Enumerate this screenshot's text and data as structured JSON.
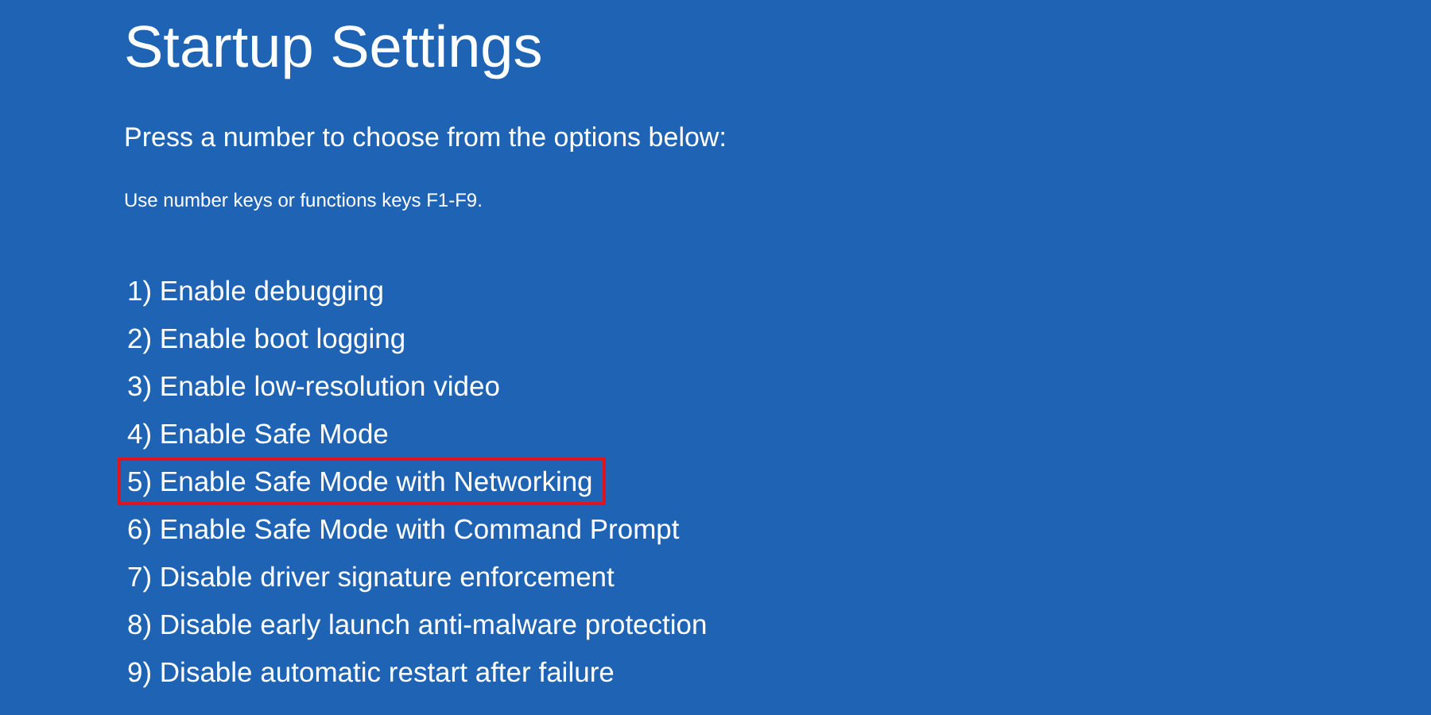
{
  "title": "Startup Settings",
  "prompt": "Press a number to choose from the options below:",
  "hint": "Use number keys or functions keys F1-F9.",
  "options": [
    {
      "label": "1) Enable debugging",
      "highlighted": false
    },
    {
      "label": "2) Enable boot logging",
      "highlighted": false
    },
    {
      "label": "3) Enable low-resolution video",
      "highlighted": false
    },
    {
      "label": "4) Enable Safe Mode",
      "highlighted": false
    },
    {
      "label": "5) Enable Safe Mode with Networking",
      "highlighted": true
    },
    {
      "label": "6) Enable Safe Mode with Command Prompt",
      "highlighted": false
    },
    {
      "label": "7) Disable driver signature enforcement",
      "highlighted": false
    },
    {
      "label": "8) Disable early launch anti-malware protection",
      "highlighted": false
    },
    {
      "label": "9) Disable automatic restart after failure",
      "highlighted": false
    }
  ]
}
